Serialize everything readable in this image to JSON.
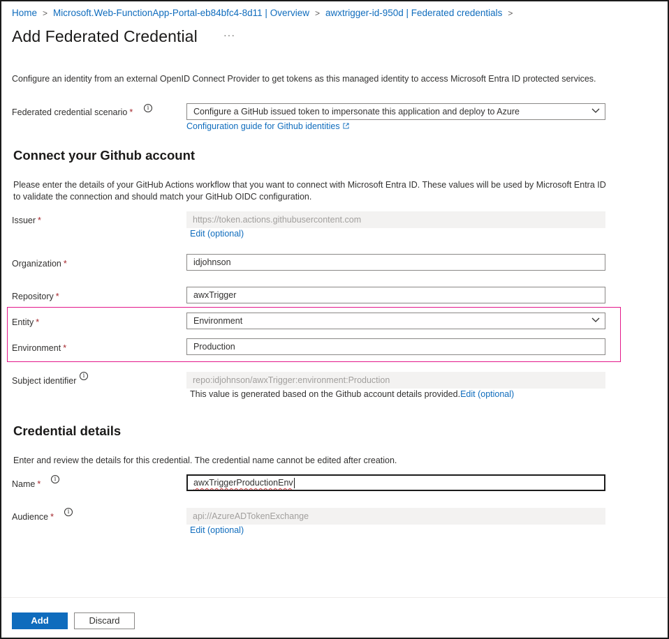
{
  "breadcrumb": {
    "home": "Home",
    "item1": "Microsoft.Web-FunctionApp-Portal-eb84bfc4-8d11 | Overview",
    "item2": "awxtrigger-id-950d | Federated credentials"
  },
  "page": {
    "title": "Add Federated Credential",
    "more": "···"
  },
  "intro": {
    "description": "Configure an identity from an external OpenID Connect Provider to get tokens as this managed identity to access Microsoft Entra ID protected services."
  },
  "scenario": {
    "label": "Federated credential scenario",
    "required": "*",
    "value": "Configure a GitHub issued token to impersonate this application and deploy to Azure",
    "guide_link": "Configuration guide for Github identities"
  },
  "github_section": {
    "title": "Connect your Github account",
    "description": "Please enter the details of your GitHub Actions workflow that you want to connect with Microsoft Entra ID. These values will be used by Microsoft Entra ID to validate the connection and should match your GitHub OIDC configuration."
  },
  "issuer": {
    "label": "Issuer",
    "required": "*",
    "value": "https://token.actions.githubusercontent.com",
    "edit_link": "Edit (optional)"
  },
  "organization": {
    "label": "Organization",
    "required": "*",
    "value": "idjohnson"
  },
  "repository": {
    "label": "Repository",
    "required": "*",
    "value": "awxTrigger"
  },
  "entity": {
    "label": "Entity",
    "required": "*",
    "value": "Environment"
  },
  "environment": {
    "label": "Environment",
    "required": "*",
    "value": "Production"
  },
  "subject": {
    "label": "Subject identifier",
    "value": "repo:idjohnson/awxTrigger:environment:Production",
    "note": "This value is generated based on the Github account details provided.",
    "edit_link": "Edit (optional)"
  },
  "credential_section": {
    "title": "Credential details",
    "description": "Enter and review the details for this credential. The credential name cannot be edited after creation."
  },
  "name": {
    "label": "Name",
    "required": "*",
    "value": "awxTriggerProductionEnv"
  },
  "audience": {
    "label": "Audience",
    "required": "*",
    "value": "api://AzureADTokenExchange",
    "edit_link": "Edit (optional)"
  },
  "footer": {
    "add_label": "Add",
    "discard_label": "Discard"
  },
  "colors": {
    "accent": "#0f6cbd",
    "required": "#a4262c",
    "highlight": "#e3178a"
  }
}
